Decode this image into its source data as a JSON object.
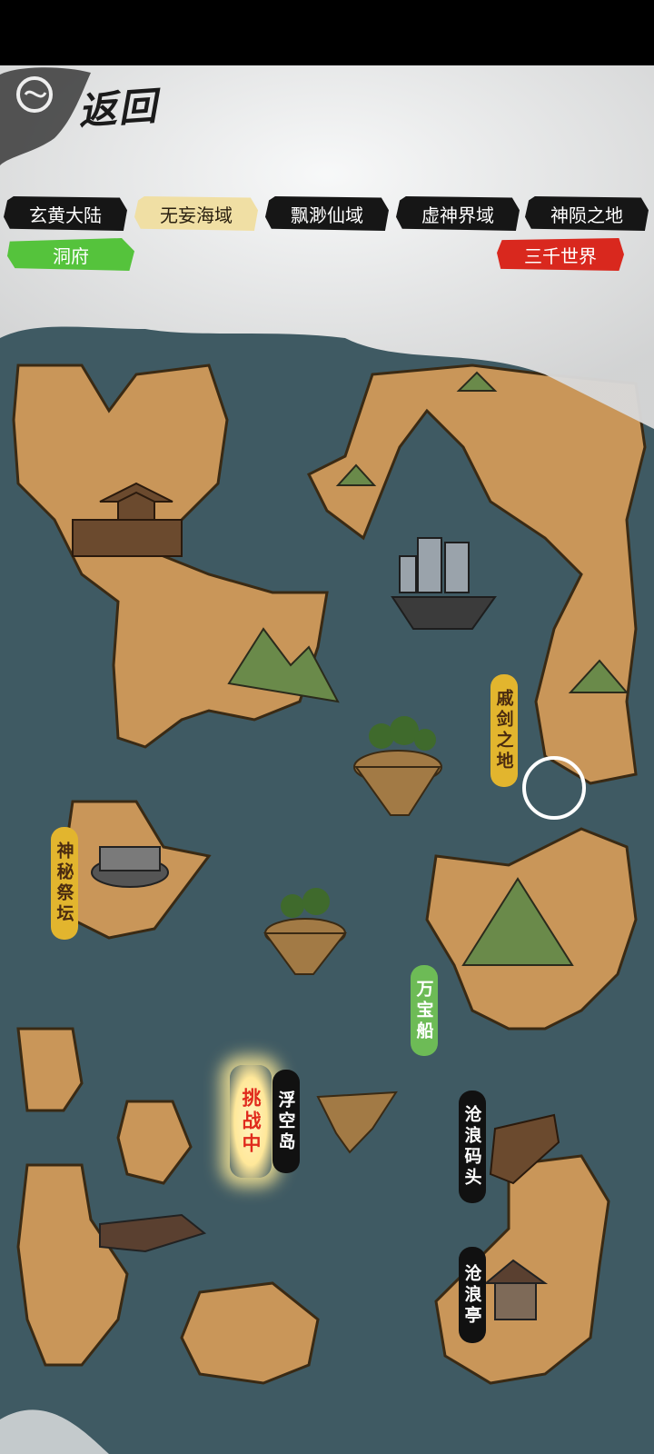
{
  "header": {
    "back_label": "返回",
    "tabs": [
      {
        "label": "玄黄大陆",
        "active": false
      },
      {
        "label": "无妄海域",
        "active": true
      },
      {
        "label": "飘渺仙域",
        "active": false
      },
      {
        "label": "虚神界域",
        "active": false
      },
      {
        "label": "神陨之地",
        "active": false
      }
    ],
    "cave_button": "洞府",
    "three_thousand_worlds_button": "三千世界"
  },
  "map": {
    "locations": [
      {
        "id": "sword-land",
        "label": "戚剑之地"
      },
      {
        "id": "mysterious-altar",
        "label": "神秘祭坛"
      },
      {
        "id": "treasure-ship",
        "label": "万宝船"
      },
      {
        "id": "floating-island",
        "label": "浮空岛",
        "status": "挑战中"
      },
      {
        "id": "canglang-pier",
        "label": "沧浪码头"
      },
      {
        "id": "canglang-pavilion",
        "label": "沧浪亭"
      }
    ]
  },
  "colors": {
    "sea": "#3f5a63",
    "land": "#c99659",
    "tab_active": "#f0dfa4",
    "green": "#55c33c",
    "red": "#d9281e",
    "gold_label": "#e2b52e"
  }
}
